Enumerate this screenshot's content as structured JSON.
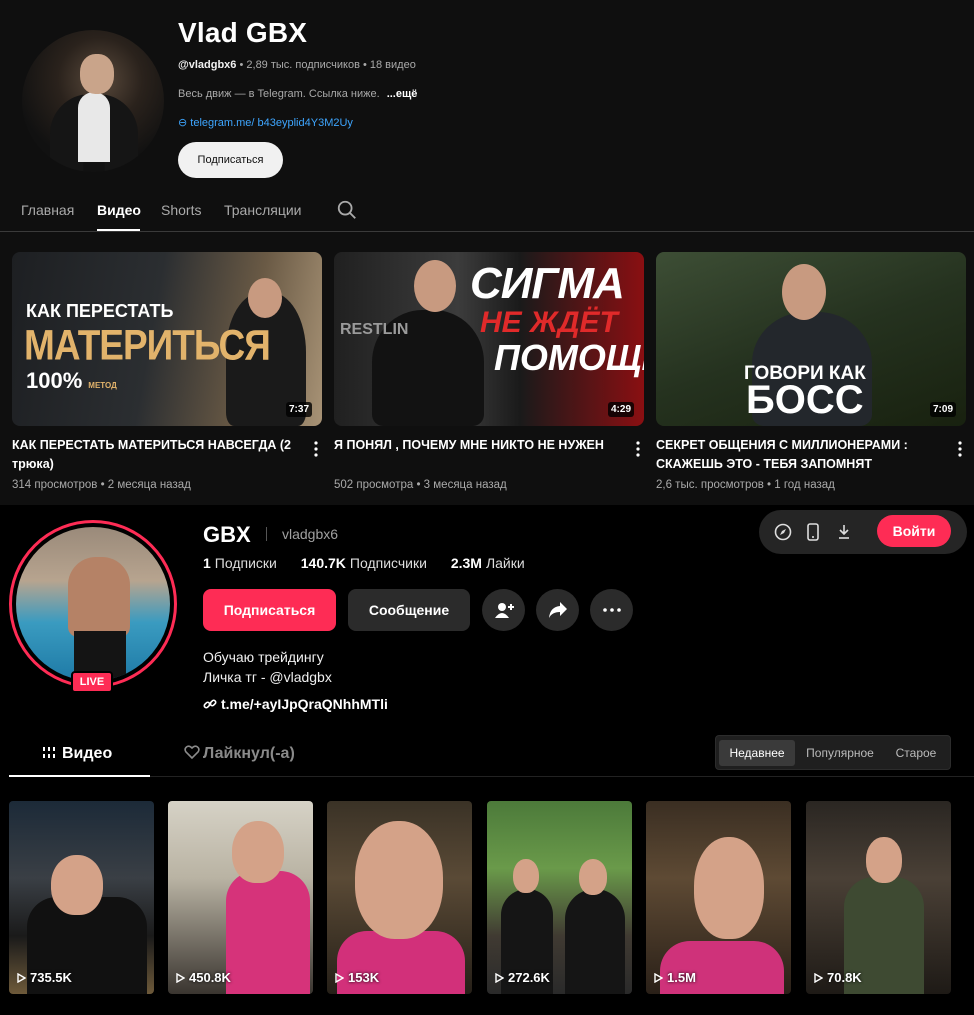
{
  "youtube": {
    "channel_name": "Vlad GBX",
    "handle": "@vladgbx6",
    "meta": "• 2,89 тыс. подписчиков • 18 видео",
    "description": "Весь движ — в Telegram. Ссылка ниже.",
    "description_more": "...ещё",
    "link": "telegram.me/ b43eyplid4Y3M2Uy",
    "subscribe_label": "Подписаться",
    "tabs": [
      "Главная",
      "Видео",
      "Shorts",
      "Трансляции"
    ],
    "active_tab": "Видео",
    "videos": [
      {
        "title": "КАК ПЕРЕСТАТЬ МАТЕРИТЬСЯ НАВСЕГДА (2 трюка)",
        "meta": "314 просмотров • 2 месяца назад",
        "duration": "7:37",
        "thumb_text": [
          "КАК ПЕРЕСТАТЬ",
          "МАТЕРИТЬСЯ",
          "100%",
          "МЕТОД"
        ]
      },
      {
        "title": "Я ПОНЯЛ , ПОЧЕМУ МНЕ НИКТО НЕ НУЖЕН",
        "meta": "502 просмотра • 3 месяца назад",
        "duration": "4:29",
        "thumb_text": [
          "СИГМА",
          "НЕ ЖДЁТ",
          "ПОМОЩИ",
          "RESTLIN"
        ]
      },
      {
        "title": "СЕКРЕТ ОБЩЕНИЯ С МИЛЛИОНЕРАМИ : СКАЖЕШЬ ЭТО - ТЕБЯ ЗАПОМНЯТ",
        "meta": "2,6 тыс. просмотров • 1 год назад",
        "duration": "7:09",
        "thumb_text": [
          "ГОВОРИ КАК",
          "БОСС"
        ]
      }
    ]
  },
  "tiktok": {
    "name": "GBX",
    "handle": "vladgbx6",
    "live_badge": "LIVE",
    "stats": [
      {
        "value": "1",
        "label": "Подписки"
      },
      {
        "value": "140.7K",
        "label": "Подписчики"
      },
      {
        "value": "2.3M",
        "label": "Лайки"
      }
    ],
    "follow_label": "Подписаться",
    "message_label": "Сообщение",
    "bio_lines": [
      "Обучаю трейдингу",
      "Личка тг - @vladgbx"
    ],
    "link": "t.me/+ayIJpQraQNhhMTli",
    "login_label": "Войти",
    "tabs": {
      "videos": "Видео",
      "liked": "Лайкнул(-а)"
    },
    "sort_options": [
      "Недавнее",
      "Популярное",
      "Старое"
    ],
    "active_sort": "Недавнее",
    "grid_views": [
      "735.5K",
      "450.8K",
      "153K",
      "272.6K",
      "1.5M",
      "70.8K"
    ]
  },
  "colors": {
    "tiktok_accent": "#fe2c55",
    "youtube_link": "#3ea6ff",
    "youtube_bg": "#0f0f0f"
  }
}
